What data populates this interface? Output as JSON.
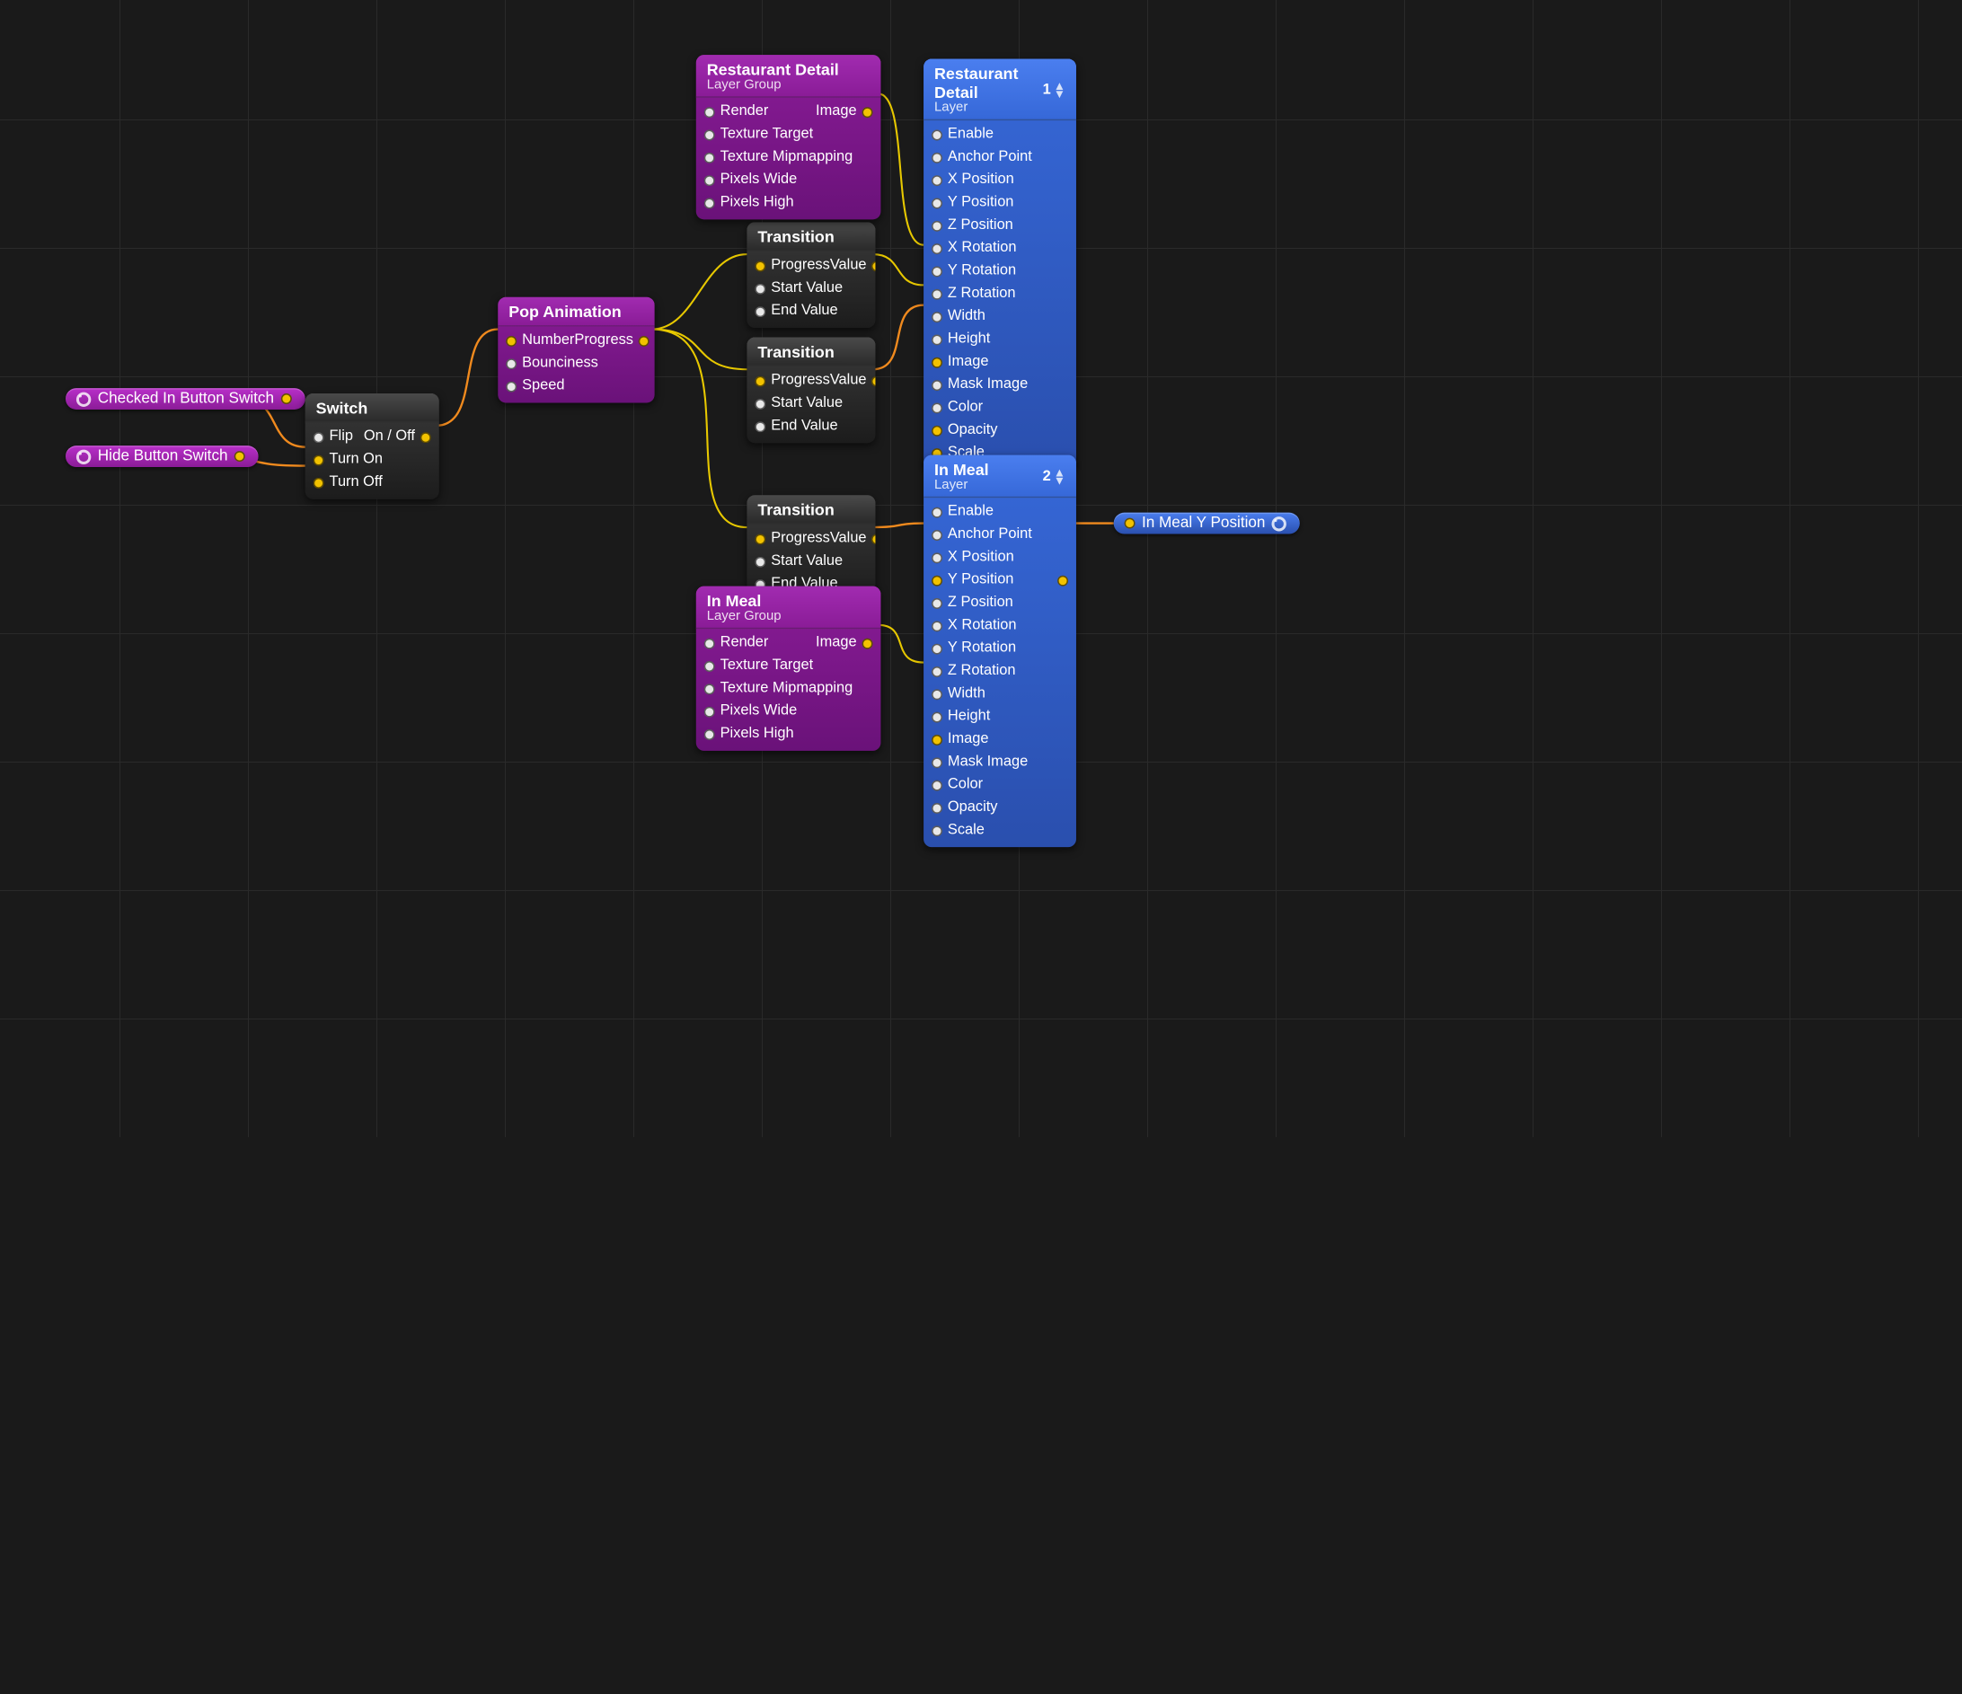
{
  "inputs": {
    "checked_in": "Checked In Button Switch",
    "hide": "Hide Button Switch"
  },
  "outputs": {
    "in_meal_y": "In Meal Y Position"
  },
  "nodes": {
    "switch": {
      "title": "Switch",
      "ports": {
        "flip": "Flip",
        "turn_on": "Turn On",
        "turn_off": "Turn Off",
        "out": "On / Off"
      }
    },
    "pop": {
      "title": "Pop Animation",
      "ports": {
        "number": "Number",
        "bounciness": "Bounciness",
        "speed": "Speed",
        "out": "Progress"
      }
    },
    "trans1": {
      "title": "Transition",
      "progress": "Progress",
      "start": "Start Value",
      "end": "End Value",
      "out": "Value"
    },
    "trans2": {
      "title": "Transition",
      "progress": "Progress",
      "start": "Start Value",
      "end": "End Value",
      "out": "Value"
    },
    "trans3": {
      "title": "Transition",
      "progress": "Progress",
      "start": "Start Value",
      "end": "End Value",
      "out": "Value"
    },
    "rd_group": {
      "title": "Restaurant Detail",
      "sub": "Layer Group",
      "render": "Render",
      "tex_target": "Texture Target",
      "tex_mip": "Texture Mipmapping",
      "px_wide": "Pixels Wide",
      "px_high": "Pixels High",
      "out": "Image"
    },
    "im_group": {
      "title": "In Meal",
      "sub": "Layer Group",
      "render": "Render",
      "tex_target": "Texture Target",
      "tex_mip": "Texture Mipmapping",
      "px_wide": "Pixels Wide",
      "px_high": "Pixels High",
      "out": "Image"
    },
    "rd_layer": {
      "title": "Restaurant Detail",
      "sub": "Layer",
      "badge": "1",
      "enable": "Enable",
      "anchor": "Anchor Point",
      "xpos": "X Position",
      "ypos": "Y Position",
      "zpos": "Z Position",
      "xrot": "X Rotation",
      "yrot": "Y Rotation",
      "zrot": "Z Rotation",
      "width": "Width",
      "height": "Height",
      "image": "Image",
      "mask": "Mask Image",
      "color": "Color",
      "opacity": "Opacity",
      "scale": "Scale"
    },
    "im_layer": {
      "title": "In Meal",
      "sub": "Layer",
      "badge": "2",
      "enable": "Enable",
      "anchor": "Anchor Point",
      "xpos": "X Position",
      "ypos": "Y Position",
      "zpos": "Z Position",
      "xrot": "X Rotation",
      "yrot": "Y Rotation",
      "zrot": "Z Rotation",
      "width": "Width",
      "height": "Height",
      "image": "Image",
      "mask": "Mask Image",
      "color": "Color",
      "opacity": "Opacity",
      "scale": "Scale"
    }
  }
}
